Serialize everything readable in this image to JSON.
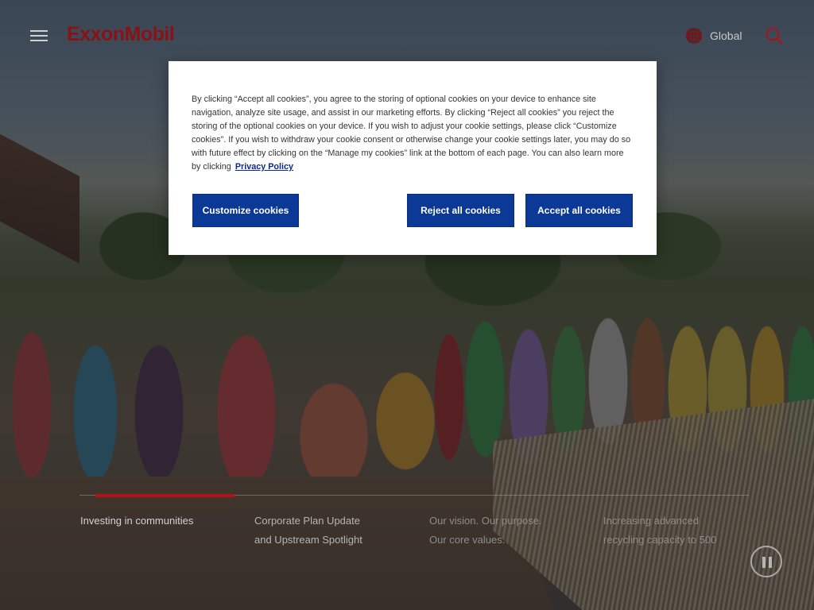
{
  "brand": {
    "logo_text": "ExxonMobil",
    "color": "#8a1214"
  },
  "header": {
    "menu_icon": "hamburger-menu-icon",
    "region": {
      "icon": "globe-icon",
      "label": "Global"
    },
    "search_icon": "search-icon",
    "search_color": "#b0141a"
  },
  "cookie_banner": {
    "text": "By clicking “Accept all cookies”, you agree to the storing of optional cookies on your device to enhance site navigation, analyze site usage, and assist in our marketing efforts. By clicking “Reject all cookies” you reject the storing of the optional cookies on your device. If you wish to adjust your cookie settings, please click “Customize cookies”. If you wish to withdraw your cookie consent or otherwise change your cookie settings later, you may do so with future effect by clicking on the “Manage my cookies” link at the bottom of each page. You can also learn more by clicking",
    "privacy_link": "Privacy Policy",
    "customize_label": "Customize cookies",
    "reject_label": "Reject all cookies",
    "accept_label": "Accept all cookies",
    "button_color": "#0c3896"
  },
  "slides": {
    "active_index": 0,
    "progress_color": "#b0141a",
    "items": [
      {
        "line1": "Investing in communities",
        "line2": ""
      },
      {
        "line1": "Corporate Plan Update",
        "line2": "and Upstream Spotlight"
      },
      {
        "line1": "Our vision. Our purpose.",
        "line2": "Our core values."
      },
      {
        "line1": "Increasing advanced",
        "line2": "recycling capacity to 500"
      }
    ],
    "pause_icon": "pause-icon"
  }
}
